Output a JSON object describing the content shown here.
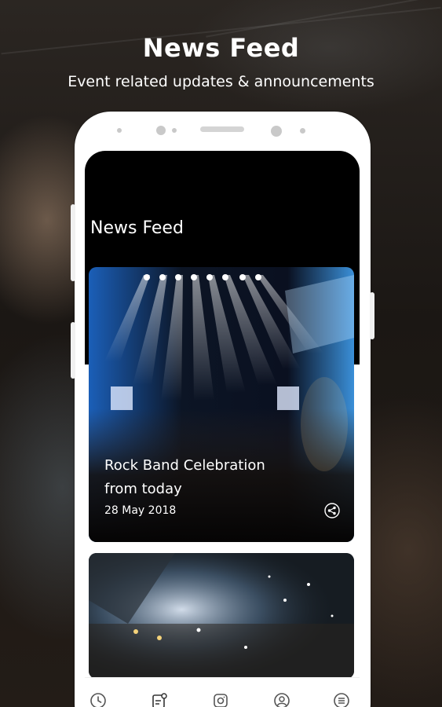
{
  "hero": {
    "title": "News Feed",
    "subtitle": "Event related updates & announcements"
  },
  "app": {
    "screen_title": "News Feed",
    "feed": [
      {
        "title": "Rock Band Celebration from today",
        "date": "28 May  2018",
        "share_icon": "share-icon"
      },
      {
        "title": "",
        "date": ""
      }
    ],
    "bottom_nav": [
      {
        "icon": "clock-icon",
        "name": "nav-schedule"
      },
      {
        "icon": "news-icon",
        "name": "nav-news-feed",
        "active": true
      },
      {
        "icon": "camera-icon",
        "name": "nav-gallery"
      },
      {
        "icon": "profile-icon",
        "name": "nav-profile"
      },
      {
        "icon": "menu-icon",
        "name": "nav-menu"
      }
    ]
  },
  "colors": {
    "header_bg": "#000000",
    "text_on_dark": "#ffffff",
    "nav_icon": "#555555",
    "stage_light": "#bfe3ff"
  }
}
